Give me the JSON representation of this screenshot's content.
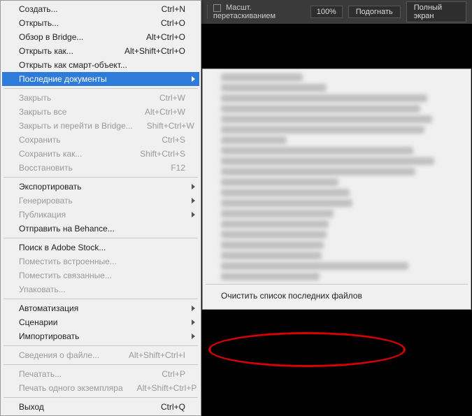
{
  "topbar": {
    "checkbox_label": "Масшт. перетаскиванием",
    "zoom_value": "100%",
    "fit_label": "Подогнать",
    "fullscreen_label": "Полный экран"
  },
  "menu": {
    "create": {
      "label": "Создать...",
      "shortcut": "Ctrl+N"
    },
    "open": {
      "label": "Открыть...",
      "shortcut": "Ctrl+O"
    },
    "browse_bridge": {
      "label": "Обзор в Bridge...",
      "shortcut": "Alt+Ctrl+O"
    },
    "open_as": {
      "label": "Открыть как...",
      "shortcut": "Alt+Shift+Ctrl+O"
    },
    "open_smart": {
      "label": "Открыть как смарт-объект..."
    },
    "recent": {
      "label": "Последние документы"
    },
    "close": {
      "label": "Закрыть",
      "shortcut": "Ctrl+W"
    },
    "close_all": {
      "label": "Закрыть все",
      "shortcut": "Alt+Ctrl+W"
    },
    "close_goto_bridge": {
      "label": "Закрыть и перейти в Bridge...",
      "shortcut": "Shift+Ctrl+W"
    },
    "save": {
      "label": "Сохранить",
      "shortcut": "Ctrl+S"
    },
    "save_as": {
      "label": "Сохранить как...",
      "shortcut": "Shift+Ctrl+S"
    },
    "revert": {
      "label": "Восстановить",
      "shortcut": "F12"
    },
    "export": {
      "label": "Экспортировать"
    },
    "generate": {
      "label": "Генерировать"
    },
    "publish": {
      "label": "Публикация"
    },
    "share_behance": {
      "label": "Отправить на Behance..."
    },
    "search_stock": {
      "label": "Поиск в Adobe Stock..."
    },
    "place_embedded": {
      "label": "Поместить встроенные..."
    },
    "place_linked": {
      "label": "Поместить связанные..."
    },
    "package": {
      "label": "Упаковать..."
    },
    "automate": {
      "label": "Автоматизация"
    },
    "scripts": {
      "label": "Сценарии"
    },
    "import": {
      "label": "Импортировать"
    },
    "file_info": {
      "label": "Сведения о файле...",
      "shortcut": "Alt+Shift+Ctrl+I"
    },
    "print": {
      "label": "Печатать...",
      "shortcut": "Ctrl+P"
    },
    "print_one": {
      "label": "Печать одного экземпляра",
      "shortcut": "Alt+Shift+Ctrl+P"
    },
    "exit": {
      "label": "Выход",
      "shortcut": "Ctrl+Q"
    }
  },
  "submenu": {
    "clear_recent": "Очистить список последних файлов"
  }
}
